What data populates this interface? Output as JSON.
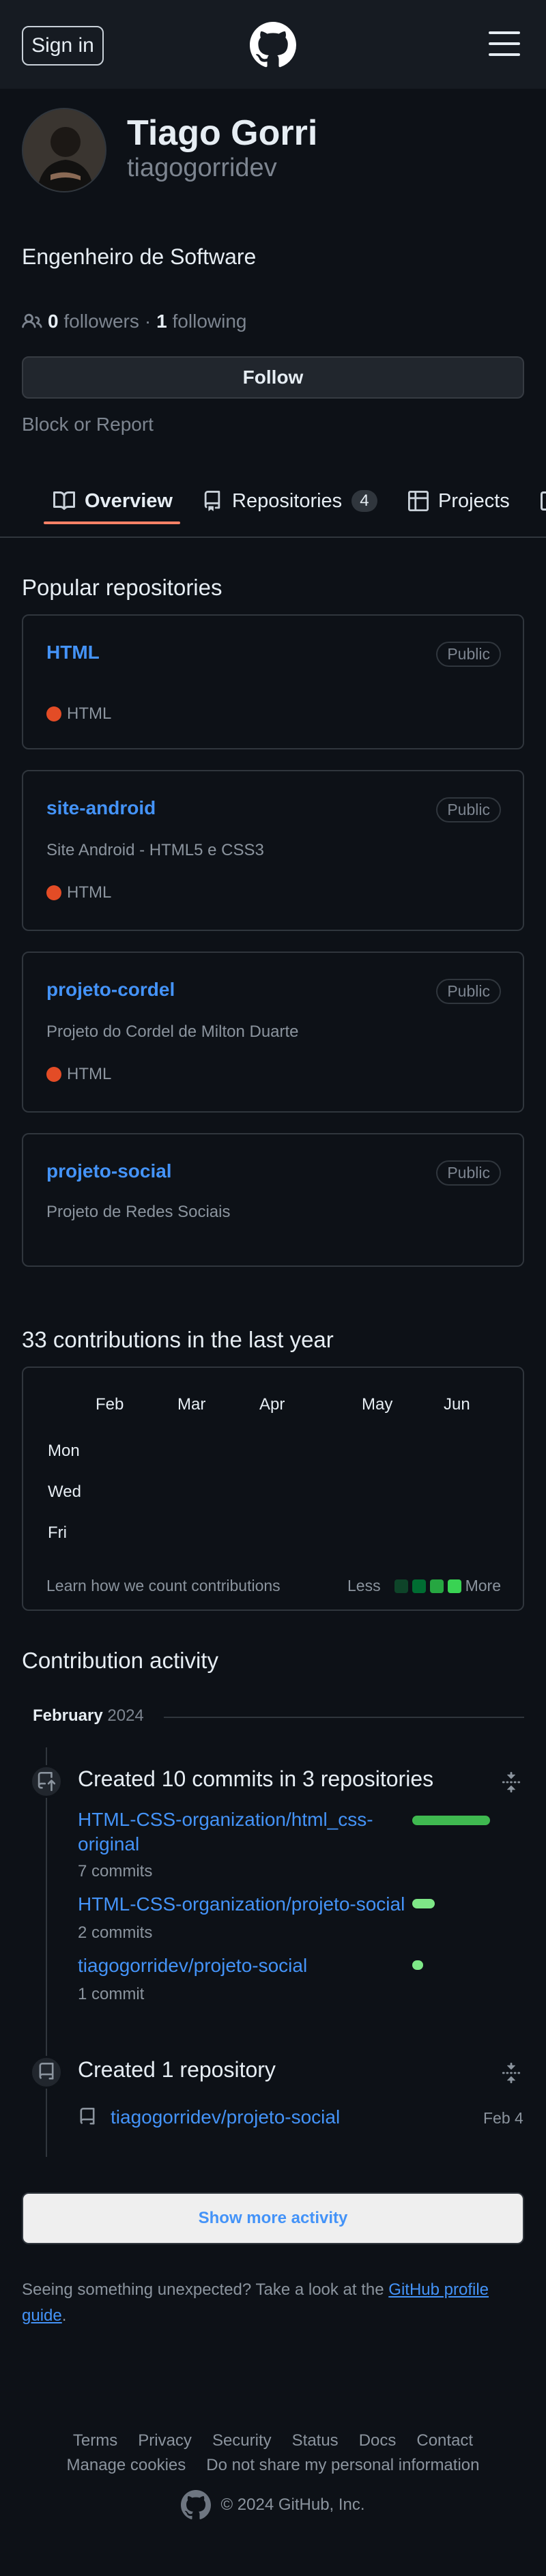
{
  "header": {
    "signin": "Sign in"
  },
  "profile": {
    "name": "Tiago Gorri",
    "username": "tiagogorridev",
    "bio": "Engenheiro de Software",
    "followers_count": "0",
    "followers_label": "followers",
    "separator": "·",
    "following_count": "1",
    "following_label": "following",
    "follow_button": "Follow",
    "block_report": "Block or Report"
  },
  "tabs": [
    {
      "label": "Overview",
      "icon": "book-icon"
    },
    {
      "label": "Repositories",
      "icon": "repo-icon",
      "count": "4"
    },
    {
      "label": "Projects",
      "icon": "table-icon"
    }
  ],
  "popular": {
    "title": "Popular repositories",
    "repos": [
      {
        "name": "HTML",
        "visibility": "Public",
        "description": "",
        "language": "HTML"
      },
      {
        "name": "site-android",
        "visibility": "Public",
        "description": "Site Android - HTML5 e CSS3",
        "language": "HTML"
      },
      {
        "name": "projeto-cordel",
        "visibility": "Public",
        "description": "Projeto do Cordel de Milton Duarte",
        "language": "HTML"
      },
      {
        "name": "projeto-social",
        "visibility": "Public",
        "description": "Projeto de Redes Sociais",
        "language": ""
      }
    ],
    "language_color": "#e34c26"
  },
  "contributions": {
    "title": "33 contributions in the last year",
    "months": [
      "Feb",
      "Mar",
      "Apr",
      "May",
      "Jun"
    ],
    "days": [
      "Mon",
      "Wed",
      "Fri"
    ],
    "learn": "Learn how we count contributions",
    "less": "Less",
    "more": "More",
    "legend_colors": [
      "#0e4429",
      "#006d32",
      "#26a641",
      "#39d353"
    ]
  },
  "activity": {
    "title": "Contribution activity",
    "month": "February",
    "year": "2024",
    "commits": {
      "title": "Created 10 commits in 3 repositories",
      "items": [
        {
          "repo": "HTML-CSS-organization/html_css-original",
          "count": "7 commits",
          "share": 1.0
        },
        {
          "repo": "HTML-CSS-organization/projeto-social",
          "count": "2 commits",
          "share": 0.29
        },
        {
          "repo": "tiagogorridev/projeto-social",
          "count": "1 commit",
          "share": 0.14
        }
      ]
    },
    "created": {
      "title": "Created 1 repository",
      "repo": "tiagogorridev/projeto-social",
      "date": "Feb 4"
    },
    "show_more": "Show more activity",
    "unexpected_text": "Seeing something unexpected? Take a look at the",
    "unexpected_link": "GitHub profile guide",
    "unexpected_end": "."
  },
  "footer": {
    "row1": [
      "Terms",
      "Privacy",
      "Security",
      "Status",
      "Docs",
      "Contact"
    ],
    "row2": [
      "Manage cookies",
      "Do not share my personal information"
    ],
    "copyright": "© 2024 GitHub, Inc."
  }
}
